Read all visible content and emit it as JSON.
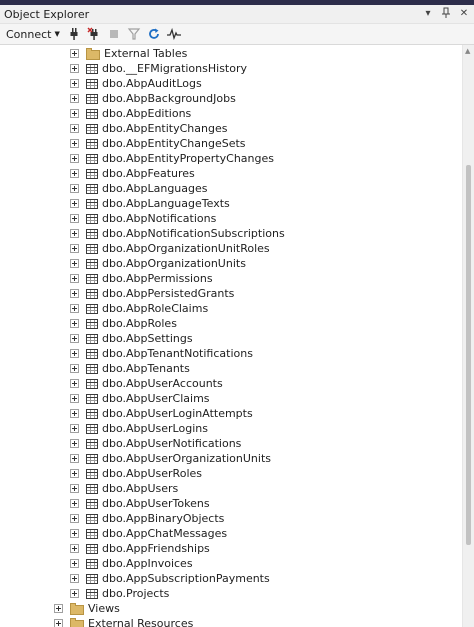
{
  "window": {
    "title": "Object Explorer",
    "controls": [
      "pin-dropdown",
      "pin",
      "close"
    ]
  },
  "toolbar": {
    "connect_label": "Connect",
    "buttons": [
      "connect-icon",
      "disconnect-icon",
      "stop-icon",
      "filter-icon",
      "refresh-icon",
      "activity-monitor-icon"
    ]
  },
  "tree": {
    "folders_top": [
      {
        "label": "External Tables"
      }
    ],
    "tables": [
      "dbo.__EFMigrationsHistory",
      "dbo.AbpAuditLogs",
      "dbo.AbpBackgroundJobs",
      "dbo.AbpEditions",
      "dbo.AbpEntityChanges",
      "dbo.AbpEntityChangeSets",
      "dbo.AbpEntityPropertyChanges",
      "dbo.AbpFeatures",
      "dbo.AbpLanguages",
      "dbo.AbpLanguageTexts",
      "dbo.AbpNotifications",
      "dbo.AbpNotificationSubscriptions",
      "dbo.AbpOrganizationUnitRoles",
      "dbo.AbpOrganizationUnits",
      "dbo.AbpPermissions",
      "dbo.AbpPersistedGrants",
      "dbo.AbpRoleClaims",
      "dbo.AbpRoles",
      "dbo.AbpSettings",
      "dbo.AbpTenantNotifications",
      "dbo.AbpTenants",
      "dbo.AbpUserAccounts",
      "dbo.AbpUserClaims",
      "dbo.AbpUserLoginAttempts",
      "dbo.AbpUserLogins",
      "dbo.AbpUserNotifications",
      "dbo.AbpUserOrganizationUnits",
      "dbo.AbpUserRoles",
      "dbo.AbpUsers",
      "dbo.AbpUserTokens",
      "dbo.AppBinaryObjects",
      "dbo.AppChatMessages",
      "dbo.AppFriendships",
      "dbo.AppInvoices",
      "dbo.AppSubscriptionPayments",
      "dbo.Projects"
    ],
    "folders_bottom": [
      {
        "label": "Views"
      },
      {
        "label": "External Resources"
      }
    ]
  },
  "colors": {
    "title_strip": "#2d2d4a",
    "folder": "#dcb867",
    "refresh_icon": "#1f6fc5"
  }
}
